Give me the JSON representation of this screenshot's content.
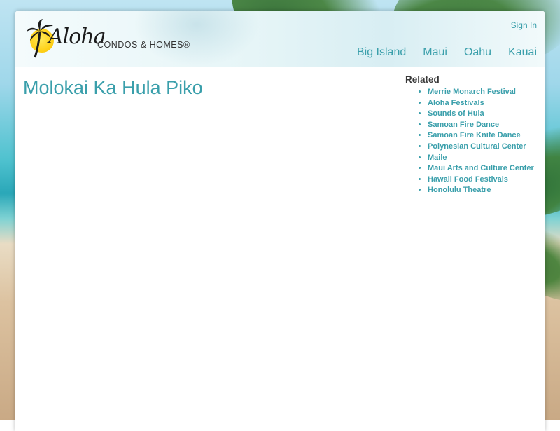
{
  "site": {
    "logo_script": "Aloha",
    "logo_sub": "CONDOS & HOMES®"
  },
  "header": {
    "signin_label": "Sign In",
    "nav": [
      "Big Island",
      "Maui",
      "Oahu",
      "Kauai"
    ]
  },
  "page": {
    "title": "Molokai Ka Hula Piko"
  },
  "related": {
    "heading": "Related",
    "items": [
      "Merrie Monarch Festival",
      "Aloha Festivals",
      "Sounds of Hula",
      "Samoan Fire Dance",
      "Samoan Fire Knife Dance",
      "Polynesian Cultural Center",
      "Maile",
      "Maui Arts and Culture Center",
      "Hawaii Food Festivals",
      "Honolulu Theatre"
    ]
  },
  "colors": {
    "accent": "#3a9fab",
    "heading": "#3a3a3a"
  }
}
